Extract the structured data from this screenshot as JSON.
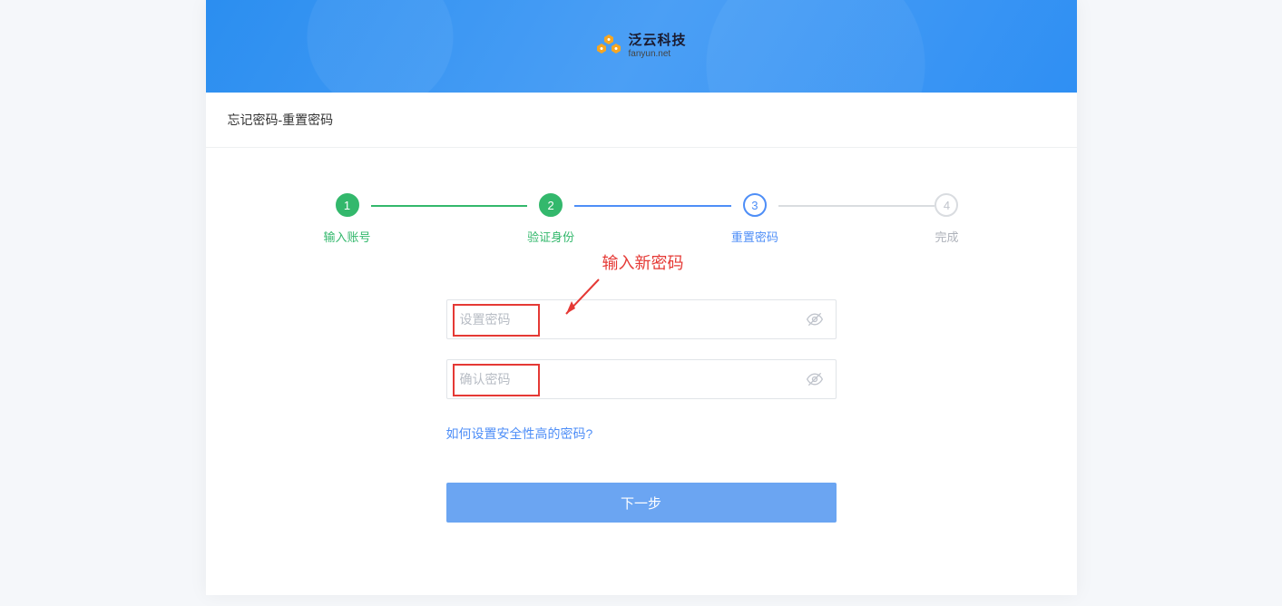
{
  "header": {
    "brand_cn": "泛云科技",
    "brand_en": "fanyun.net"
  },
  "page": {
    "title": "忘记密码-重置密码"
  },
  "steps": {
    "items": [
      {
        "num": "1",
        "label": "输入账号"
      },
      {
        "num": "2",
        "label": "验证身份"
      },
      {
        "num": "3",
        "label": "重置密码"
      },
      {
        "num": "4",
        "label": "完成"
      }
    ]
  },
  "annotation": {
    "text": "输入新密码"
  },
  "form": {
    "password_placeholder": "设置密码",
    "confirm_placeholder": "确认密码",
    "help_link": "如何设置安全性高的密码?",
    "submit": "下一步"
  },
  "colors": {
    "brand_blue": "#4e8ef7",
    "success_green": "#33b86c",
    "annotation_red": "#e53935"
  }
}
